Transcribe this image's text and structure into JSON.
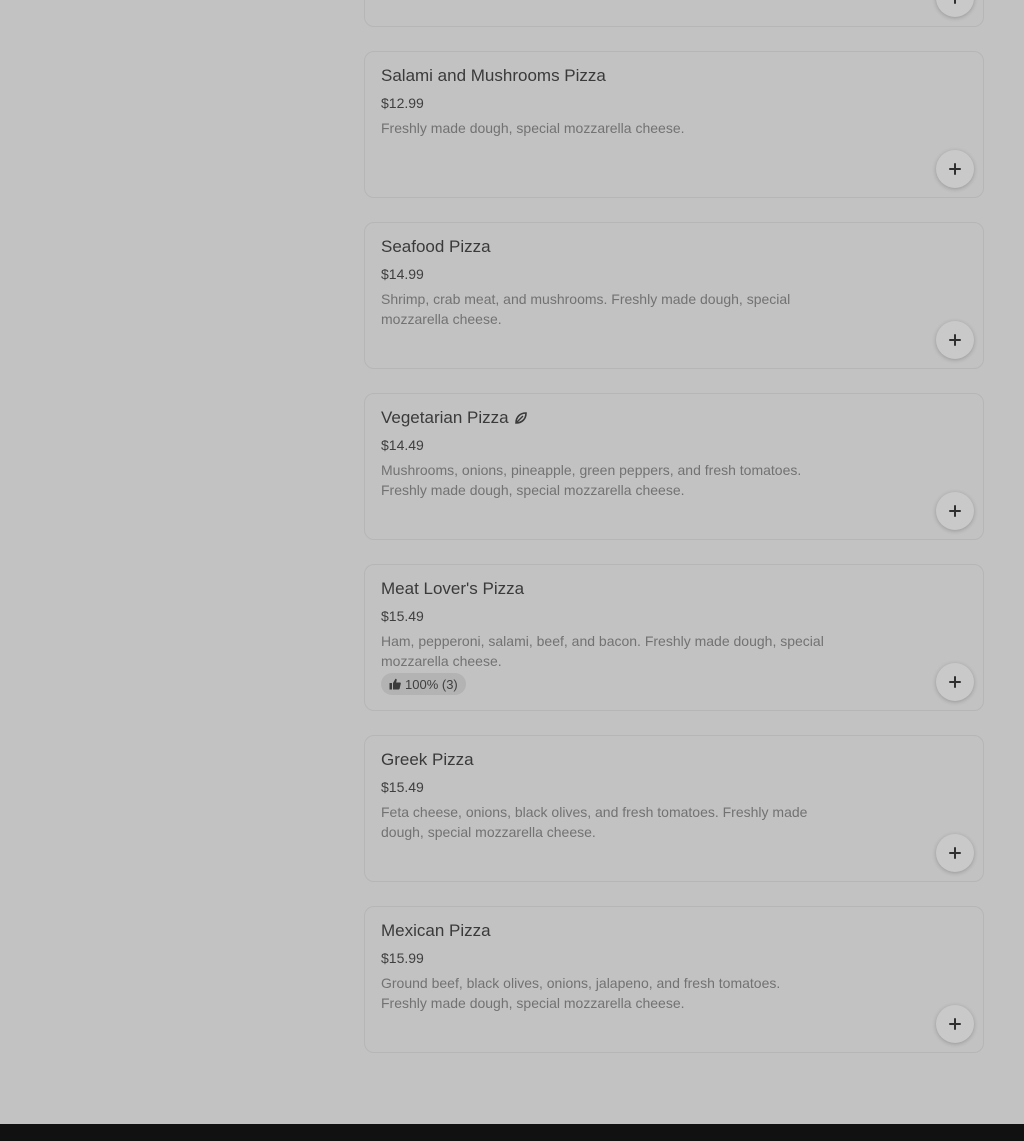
{
  "menu": {
    "items": [
      {
        "name": "",
        "price": "",
        "description": ""
      },
      {
        "name": "Salami and Mushrooms Pizza",
        "price": "$12.99",
        "description": "Freshly made dough, special mozzarella cheese."
      },
      {
        "name": "Seafood Pizza",
        "price": "$14.99",
        "description": "Shrimp, crab meat, and mushrooms. Freshly made dough, special mozzarella cheese."
      },
      {
        "name": "Vegetarian Pizza",
        "price": "$14.49",
        "description": "Mushrooms, onions, pineapple, green peppers, and fresh tomatoes. Freshly made dough, special mozzarella cheese.",
        "icon": "leaf-icon"
      },
      {
        "name": "Meat Lover's Pizza",
        "price": "$15.49",
        "description": "Ham, pepperoni, salami, beef, and bacon. Freshly made dough, special mozzarella cheese.",
        "rating": "100% (3)",
        "rating_icon": "thumbs-up-icon"
      },
      {
        "name": "Greek Pizza",
        "price": "$15.49",
        "description": "Feta cheese, onions, black olives, and fresh tomatoes. Freshly made dough, special mozzarella cheese."
      },
      {
        "name": "Mexican Pizza",
        "price": "$15.99",
        "description": "Ground beef, black olives, onions, jalapeno, and fresh tomatoes. Freshly made dough, special mozzarella cheese."
      }
    ],
    "add_button_icon": "plus-icon"
  },
  "colors": {
    "background": "#c2c2c2",
    "footer": "#111111"
  }
}
